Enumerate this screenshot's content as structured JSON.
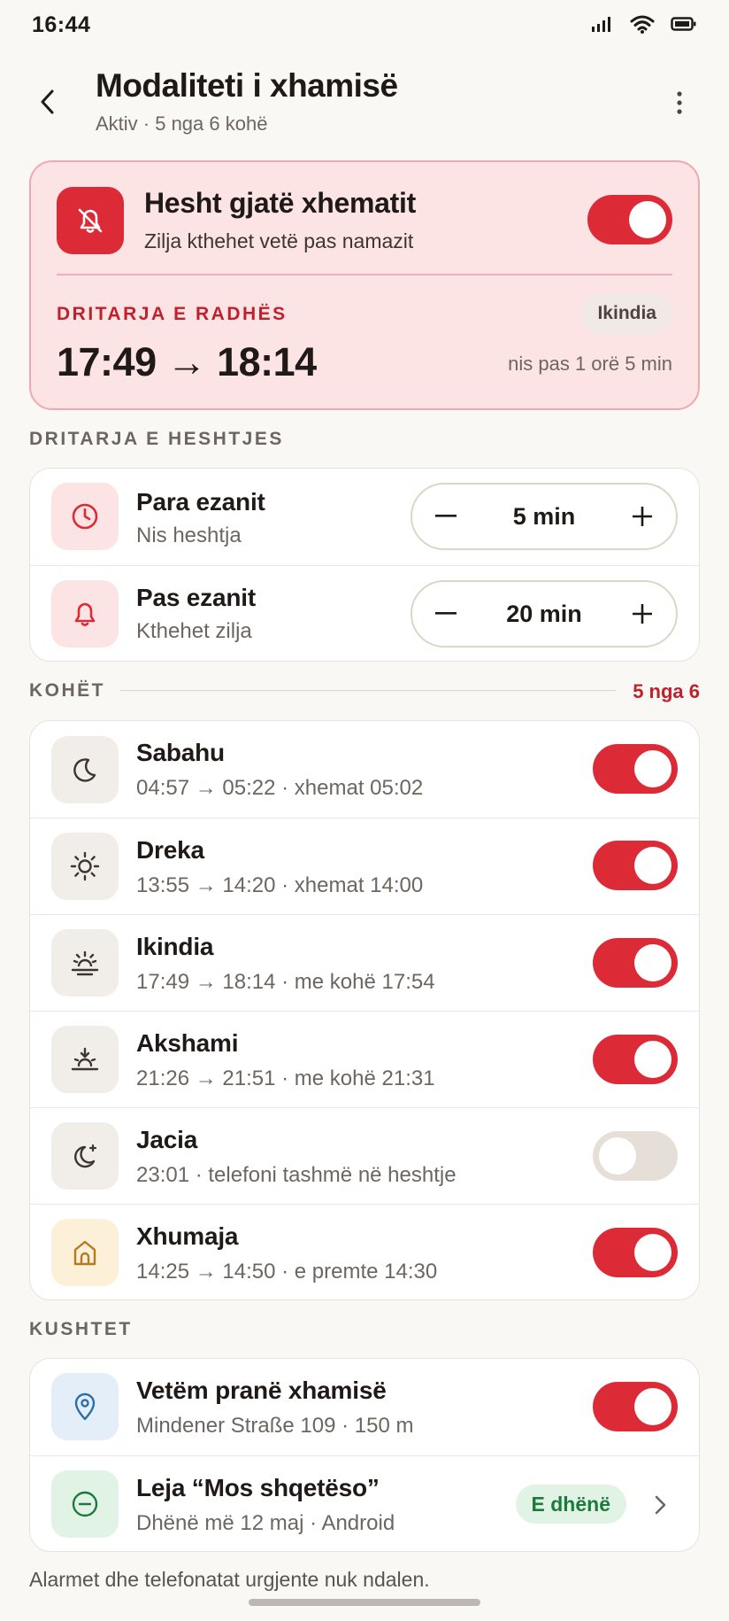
{
  "status": {
    "time": "16:44"
  },
  "header": {
    "title": "Modaliteti i xhamisë",
    "subtitle": "Aktiv · 5 nga 6 kohë"
  },
  "hero": {
    "title": "Hesht gjatë xhematit",
    "subtitle": "Zilja kthehet vetë pas namazit",
    "enabled": true,
    "next_label": "DRITARJA E RADHËS",
    "next_prayer": "Ikindia",
    "range": "17:49 → 18:14",
    "starts_in": "nis pas 1 orë 5 min"
  },
  "window": {
    "heading": "DRITARJA E HESHTJES",
    "rows": [
      {
        "icon": "clock-icon",
        "title": "Para ezanit",
        "subtitle": "Nis heshtja",
        "value": "5 min"
      },
      {
        "icon": "bell-icon",
        "title": "Pas ezanit",
        "subtitle": "Kthehet zilja",
        "value": "20 min"
      }
    ]
  },
  "times": {
    "heading": "KOHËT",
    "count": "5 nga 6",
    "rows": [
      {
        "icon": "moon-icon",
        "title": "Sabahu",
        "subtitle": "04:57 → 05:22 · xhemat 05:02",
        "enabled": true
      },
      {
        "icon": "sun-icon",
        "title": "Dreka",
        "subtitle": "13:55 → 14:20 · xhemat 14:00",
        "enabled": true
      },
      {
        "icon": "sun-horizon-icon",
        "title": "Ikindia",
        "subtitle": "17:49 → 18:14 · me kohë 17:54",
        "enabled": true
      },
      {
        "icon": "sunset-icon",
        "title": "Akshami",
        "subtitle": "21:26 → 21:51 · me kohë 21:31",
        "enabled": true
      },
      {
        "icon": "moon-star-icon",
        "title": "Jacia",
        "subtitle": "23:01 · telefoni tashmë në heshtje",
        "enabled": false
      },
      {
        "icon": "mosque-icon",
        "title": "Xhumaja",
        "subtitle": "14:25 → 14:50 · e premte 14:30",
        "enabled": true
      }
    ]
  },
  "conditions": {
    "heading": "KUSHTET",
    "location": {
      "icon": "location-pin-icon",
      "title": "Vetëm pranë xhamisë",
      "subtitle": "Mindener Straße 109 · 150 m",
      "enabled": true
    },
    "dnd": {
      "icon": "do-not-disturb-icon",
      "title": "Leja “Mos shqetëso”",
      "subtitle": "Dhënë më 12 maj · Android",
      "badge": "E dhënë"
    }
  },
  "footer": "Alarmet dhe telefonatat urgjente nuk ndalen.",
  "colors": {
    "accent": "#DD2A37",
    "accent_text": "#C01F2C",
    "background": "#FAF8F5",
    "hero_bg": "#FCE4E4",
    "granted": "#1E7A3C"
  }
}
